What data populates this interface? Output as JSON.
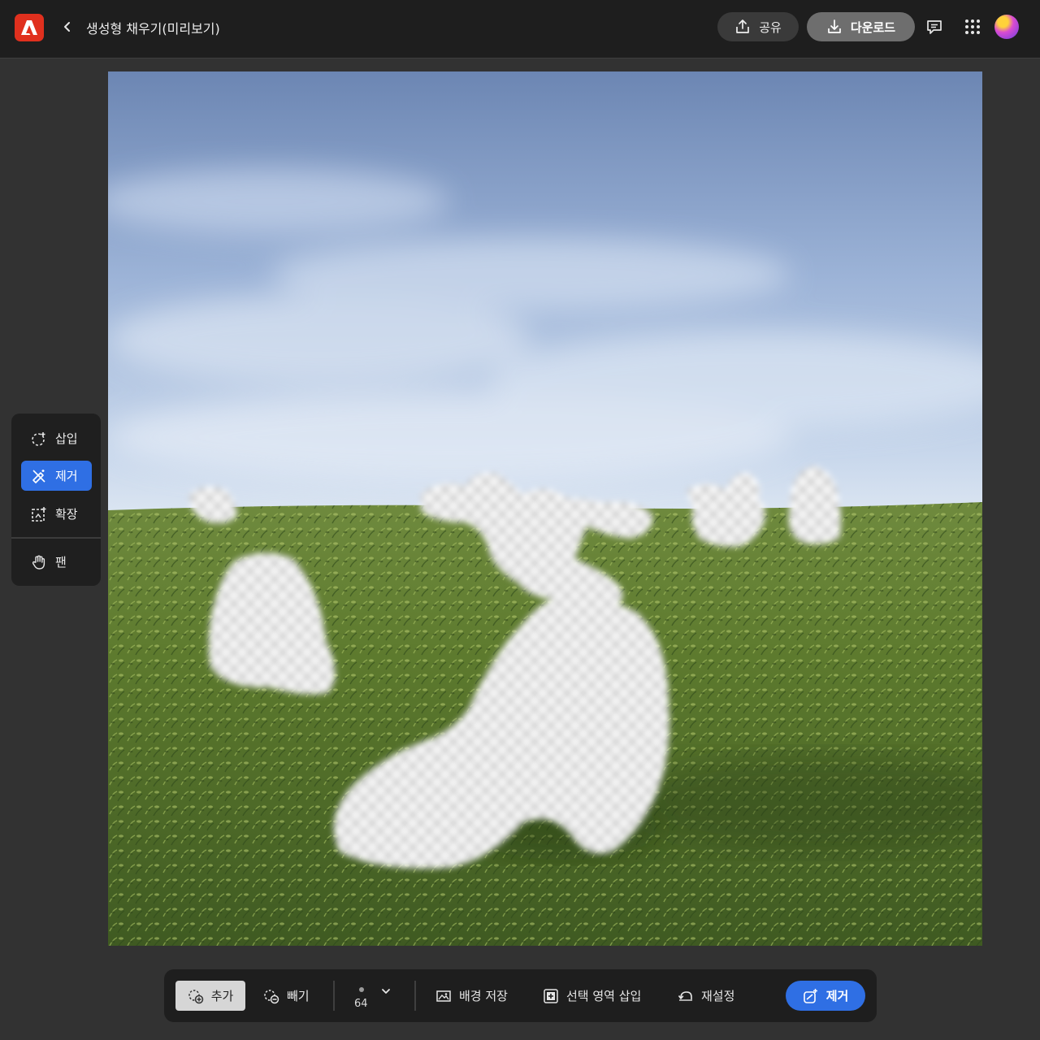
{
  "header": {
    "document_title": "생성형 채우기(미리보기)",
    "share_label": "공유",
    "download_label": "다운로드"
  },
  "tools": [
    {
      "label": "삽입",
      "icon": "insert-icon",
      "active": false
    },
    {
      "label": "제거",
      "icon": "remove-brush-icon",
      "active": true
    },
    {
      "label": "확장",
      "icon": "expand-icon",
      "active": false
    },
    {
      "label": "팬",
      "icon": "hand-icon",
      "active": false
    }
  ],
  "toolbar": {
    "add_label": "추가",
    "subtract_label": "빼기",
    "brush_size": "64",
    "save_background_label": "배경 저장",
    "insert_selection_label": "선택 영역 삽입",
    "reset_label": "재설정",
    "remove_label": "제거"
  },
  "colors": {
    "accent": "#2f6fe4",
    "app_logo": "#e0301e",
    "topbar": "#1e1e1e",
    "workspace": "#323232"
  }
}
